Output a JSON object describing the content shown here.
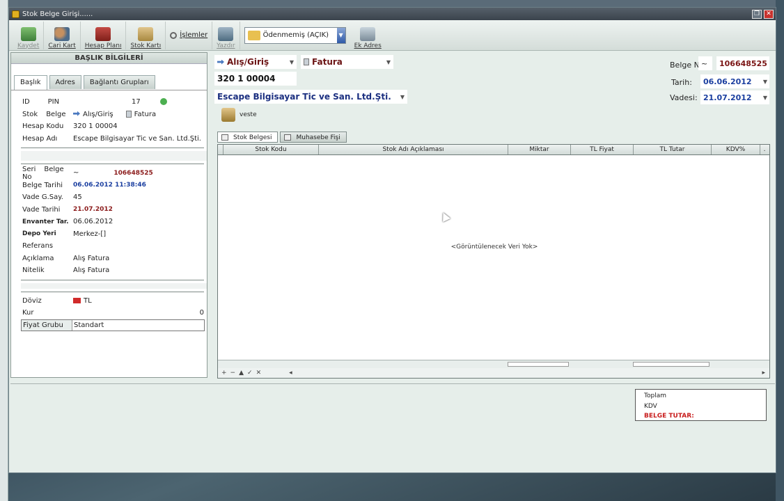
{
  "window": {
    "title": "Stok Belge Girişi......"
  },
  "toolbar": {
    "save": "Kaydet",
    "cari_kart": "Cari Kart",
    "hesap_plani": "Hesap Planı",
    "stok_karti": "Stok Kartı",
    "islemler": "İşlemler",
    "yazdir": "Yazdır",
    "status_value": "Ödenmemiş (AÇIK)",
    "ek_adres": "Ek Adres"
  },
  "left": {
    "header": "BAŞLIK BİLGİLERİ",
    "tabs": [
      "Başlık",
      "Adres",
      "Bağlantı Grupları"
    ],
    "rows": [
      {
        "label": "ID",
        "label2": "PIN",
        "value": "17"
      },
      {
        "label": "Stok",
        "label2": "Belge",
        "value": "Alış/Giriş",
        "value2": "Fatura"
      },
      {
        "label": "Hesap Kodu",
        "value": "320 1 00004"
      },
      {
        "label": "Hesap Adı",
        "value": "Escape Bilgisayar Tic ve San. Ltd.Şti."
      }
    ],
    "rows2": [
      {
        "label": "Seri",
        "label2": "Belge No",
        "value": "~",
        "value2": "106648525"
      },
      {
        "label": "Belge Tarihi",
        "value": "06.06.2012 11:38:46"
      },
      {
        "label": "Vade G.Say.",
        "value": "45"
      },
      {
        "label": "Vade Tarihi",
        "value": "21.07.2012"
      },
      {
        "label": "Envanter Tar.",
        "value": "06.06.2012"
      },
      {
        "label": "Depo Yeri",
        "value": "Merkez-[]"
      },
      {
        "label": "Referans",
        "value": ""
      },
      {
        "label": "Açıklama",
        "value": "Alış Fatura"
      },
      {
        "label": "Nitelik",
        "value": "Alış Fatura"
      }
    ],
    "rows3": [
      {
        "label": "Döviz",
        "value": "TL"
      },
      {
        "label": "Kur",
        "value": "0"
      },
      {
        "label": "Fiyat Grubu",
        "value": "Standart"
      }
    ]
  },
  "header": {
    "doc_type": "Alış/Giriş",
    "doc_kind": "Fatura",
    "account_code": "320 1 00004",
    "account_name": "Escape Bilgisayar Tic ve San. Ltd.Şti.",
    "belge_no_label": "Belge No",
    "belge_no_prefix": "~",
    "belge_no": "106648525",
    "tarih_label": "Tarih:",
    "tarih": "06.06.2012",
    "vadesi_label": "Vadesi:",
    "vadesi": "21.07.2012",
    "veste": "veste"
  },
  "grid": {
    "tabs": [
      "Stok Belgesi",
      "Muhasebe Fişi"
    ],
    "columns": [
      "Stok Kodu",
      "Stok Adı Açıklaması",
      "Miktar",
      "TL Fiyat",
      "TL Tutar",
      "KDV%",
      "."
    ],
    "empty_text": "<Görüntülenecek Veri Yok>",
    "nav": [
      "+",
      "−",
      "▲",
      "✓",
      "✕"
    ]
  },
  "totals": {
    "toplam": "Toplam",
    "kdv": "KDV",
    "belge_tutar": "BELGE TUTAR:"
  }
}
